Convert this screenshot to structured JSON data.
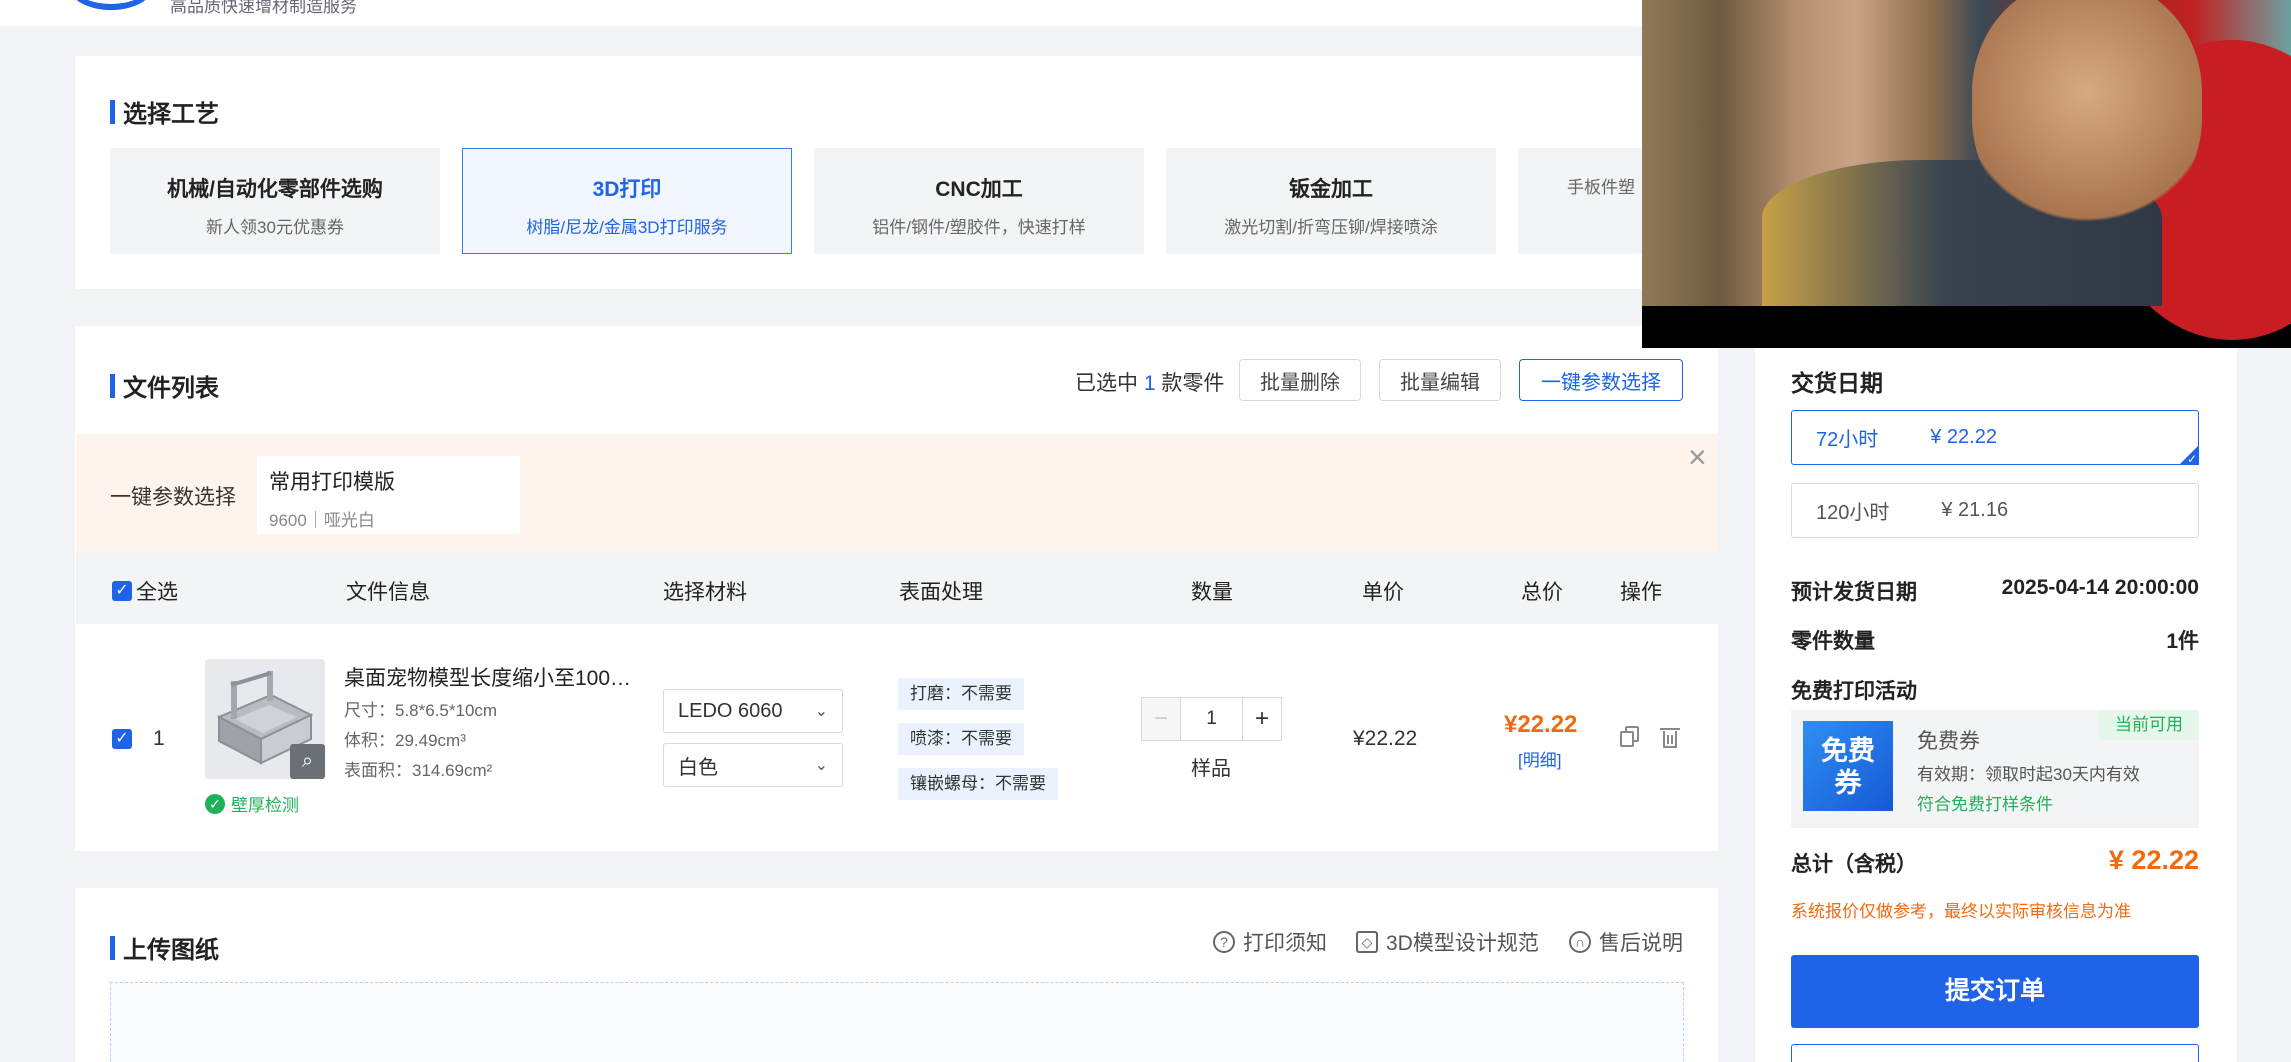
{
  "header": {
    "slogan": "高品质快速增材制造服务"
  },
  "process": {
    "title": "选择工艺",
    "cards": [
      {
        "title": "机械/自动化零部件选购",
        "subtitle": "新人领30元优惠券"
      },
      {
        "title": "3D打印",
        "subtitle": "树脂/尼龙/金属3D打印服务"
      },
      {
        "title": "CNC加工",
        "subtitle": "铝件/钢件/塑胶件，快速打样"
      },
      {
        "title": "钣金加工",
        "subtitle": "激光切割/折弯压铆/焊接喷涂"
      },
      {
        "title": "",
        "subtitle": "手板件塑"
      }
    ]
  },
  "file_list": {
    "title": "文件列表",
    "selected_prefix": "已选中",
    "selected_count": "1",
    "selected_suffix": "款零件",
    "batch_delete": "批量删除",
    "batch_edit": "批量编辑",
    "one_click_params": "一键参数选择",
    "param_bar": {
      "label": "一键参数选择",
      "template_name": "常用打印模版",
      "template_sub": "9600｜哑光白"
    },
    "columns": [
      "全选",
      "文件信息",
      "选择材料",
      "表面处理",
      "数量",
      "单价",
      "总价",
      "操作"
    ],
    "row": {
      "index": "1",
      "name": "桌面宠物模型长度缩小至100…",
      "size": "尺寸：5.8*6.5*10cm",
      "volume": "体积：29.49cm³",
      "area": "表面积：314.69cm²",
      "wall_check": "壁厚检测",
      "material": "LEDO 6060",
      "color": "白色",
      "surfaces": [
        "打磨：不需要",
        "喷漆：不需要",
        "镶嵌螺母：不需要"
      ],
      "quantity": "1",
      "quantity_label": "样品",
      "unit_price": "¥22.22",
      "total_price": "¥22.22",
      "detail_link": "[明细]"
    }
  },
  "upload": {
    "title": "上传图纸",
    "links": [
      "打印须知",
      "3D模型设计规范",
      "售后说明"
    ]
  },
  "order": {
    "delivery_title": "交货日期",
    "options": [
      {
        "label": "72小时",
        "price": "¥ 22.22",
        "selected": true
      },
      {
        "label": "120小时",
        "price": "¥ 21.16",
        "selected": false
      }
    ],
    "ship_date_label": "预计发货日期",
    "ship_date": "2025-04-14 20:00:00",
    "part_count_label": "零件数量",
    "part_count": "1件",
    "free_title": "免费打印活动",
    "coupon": {
      "image_text": "免费券",
      "name": "免费券",
      "validity": "有效期：领取时起30天内有效",
      "eligible": "符合免费打样条件",
      "badge": "当前可用"
    },
    "total_label": "总计（含税）",
    "total": "¥ 22.22",
    "disclaimer": "系统报价仅做参考，最终以实际审核信息为准",
    "submit": "提交订单"
  },
  "colors": {
    "accent": "#1f63e8",
    "price": "#f26a10",
    "success": "#20b15a"
  }
}
